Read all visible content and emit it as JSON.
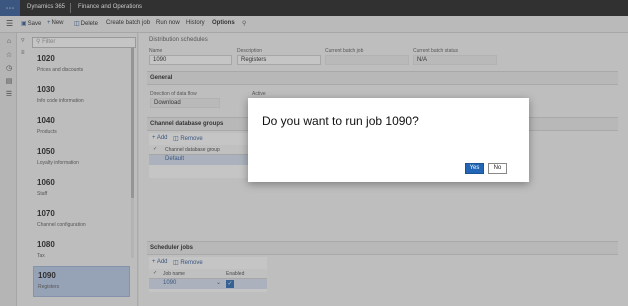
{
  "topbar": {
    "app_name": "Dynamics 365",
    "module_name": "Finance and Operations"
  },
  "actions": {
    "save": "Save",
    "new": "New",
    "delete": "Delete",
    "create_batch_job": "Create batch job",
    "run_now": "Run now",
    "history": "History",
    "options": "Options"
  },
  "list": {
    "filter_placeholder": "Filter",
    "items": [
      {
        "number": "1020",
        "name": "Prices and discounts"
      },
      {
        "number": "1030",
        "name": "Info code information"
      },
      {
        "number": "1040",
        "name": "Products"
      },
      {
        "number": "1050",
        "name": "Loyalty information"
      },
      {
        "number": "1060",
        "name": "Staff"
      },
      {
        "number": "1070",
        "name": "Channel configuration"
      },
      {
        "number": "1080",
        "name": "Tax"
      },
      {
        "number": "1090",
        "name": "Registers"
      }
    ]
  },
  "details": {
    "breadcrumb": "Distribution schedules",
    "name_label": "Name",
    "name_value": "1090",
    "description_label": "Description",
    "description_value": "Registers",
    "current_batch_job_label": "Current batch job",
    "current_batch_status_label": "Current batch status",
    "current_batch_status_value": "N/A"
  },
  "general": {
    "title": "General",
    "direction_label": "Direction of data flow",
    "direction_value": "Download",
    "active_label": "Active"
  },
  "channel_groups": {
    "title": "Channel database groups",
    "add": "Add",
    "remove": "Remove",
    "column": "Channel database group",
    "row_value": "Default"
  },
  "scheduler": {
    "title": "Scheduler jobs",
    "add": "Add",
    "remove": "Remove",
    "col_job_name": "Job name",
    "col_enabled": "Enabled",
    "row_job": "1090"
  },
  "dialog": {
    "message": "Do you want to run job 1090?",
    "yes": "Yes",
    "no": "No"
  },
  "colors": {
    "accent": "#2b5797",
    "selected_row": "#b7c9e6",
    "yes_button": "#2266b5"
  }
}
